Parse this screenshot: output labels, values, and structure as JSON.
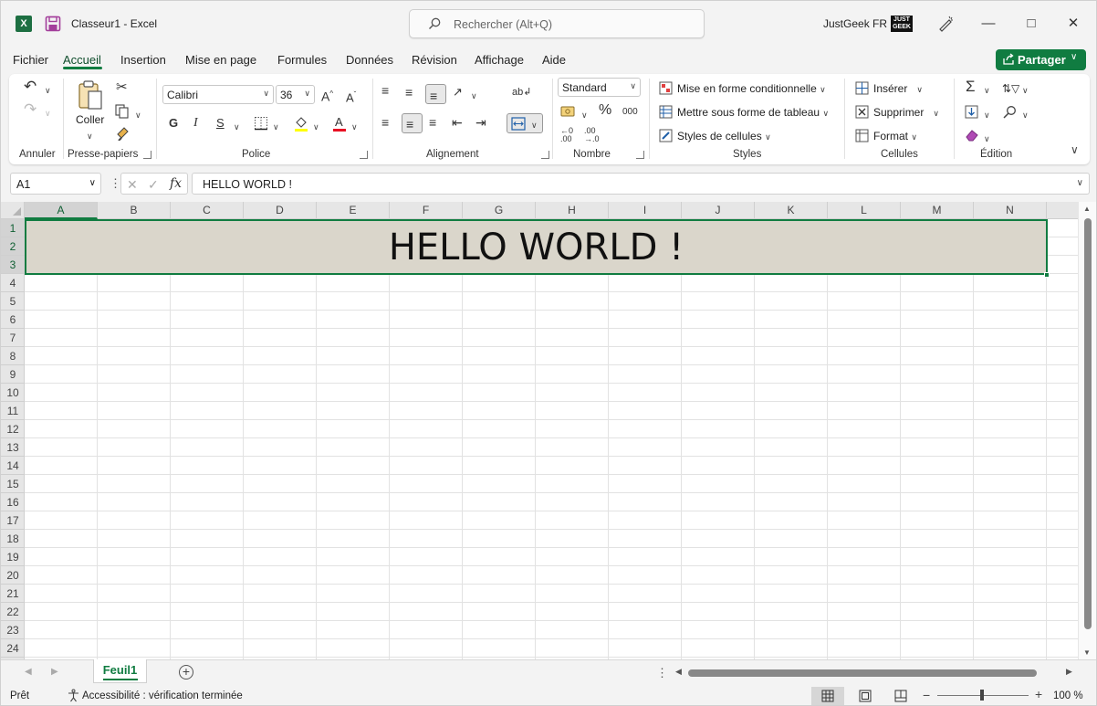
{
  "titlebar": {
    "app_logo": "X",
    "doc_title": "Classeur1  -  Excel",
    "search_placeholder": "Rechercher (Alt+Q)",
    "user_name": "JustGeek FR",
    "avatar_text": "JUST GEEK"
  },
  "tabs": [
    {
      "label": "Fichier"
    },
    {
      "label": "Accueil"
    },
    {
      "label": "Insertion"
    },
    {
      "label": "Mise en page"
    },
    {
      "label": "Formules"
    },
    {
      "label": "Données"
    },
    {
      "label": "Révision"
    },
    {
      "label": "Affichage"
    },
    {
      "label": "Aide"
    }
  ],
  "share_label": "Partager",
  "ribbon": {
    "groups": {
      "undo": "Annuler",
      "clipboard": "Presse-papiers",
      "font": "Police",
      "alignment": "Alignement",
      "number": "Nombre",
      "styles": "Styles",
      "cells": "Cellules",
      "editing": "Édition"
    },
    "paste_label": "Coller",
    "font_name": "Calibri",
    "font_size": "36",
    "bold": "G",
    "italic": "I",
    "underline": "S",
    "number_format": "Standard",
    "percent": "%",
    "thousands": "000",
    "conditional_format": "Mise en forme conditionnelle",
    "format_as_table": "Mettre sous forme de tableau",
    "cell_styles": "Styles de cellules",
    "insert": "Insérer",
    "delete": "Supprimer",
    "format": "Format"
  },
  "formula_bar": {
    "name_box": "A1",
    "fx": "fx",
    "formula": "HELLO WORLD !"
  },
  "grid": {
    "columns": [
      "A",
      "B",
      "C",
      "D",
      "E",
      "F",
      "G",
      "H",
      "I",
      "J",
      "K",
      "L",
      "M",
      "N"
    ],
    "rows": [
      "1",
      "2",
      "3",
      "4",
      "5",
      "6",
      "7",
      "8",
      "9",
      "10",
      "11",
      "12",
      "13",
      "14",
      "15",
      "16",
      "17",
      "18",
      "19",
      "20",
      "21",
      "22",
      "23",
      "24"
    ],
    "merged_cell_text": "HELLO WORLD !"
  },
  "sheet": {
    "tab_name": "Feuil1"
  },
  "status": {
    "ready": "Prêt",
    "accessibility": "Accessibilité : vérification terminée",
    "zoom": "100 %"
  },
  "colors": {
    "accent": "#107c41",
    "merged_fill": "#dad6cb"
  }
}
